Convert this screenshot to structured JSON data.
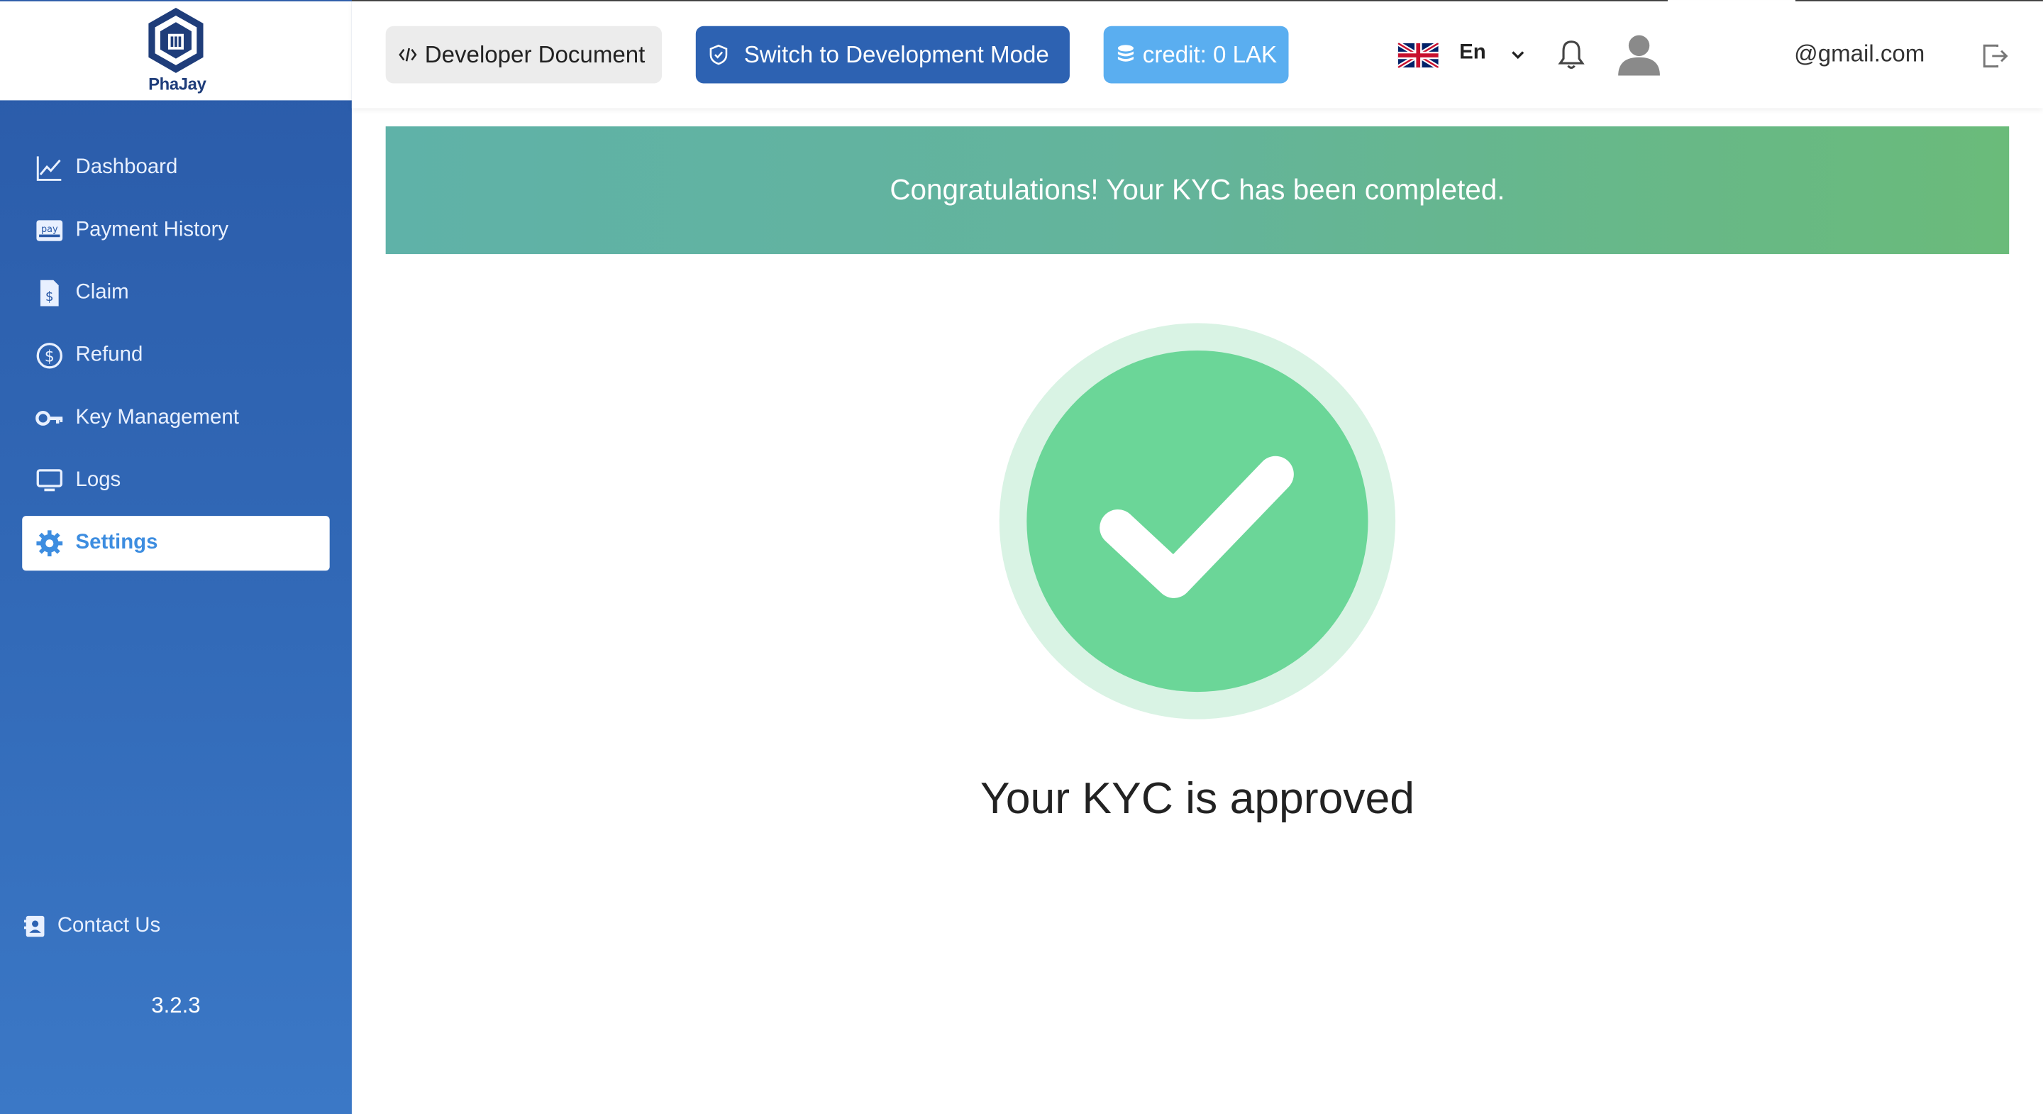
{
  "app": {
    "brand": "PhaJay",
    "version": "3.2.3"
  },
  "sidebar": {
    "items": [
      {
        "label": "Dashboard",
        "icon": "chart-line-icon"
      },
      {
        "label": "Payment History",
        "icon": "pay-card-icon"
      },
      {
        "label": "Claim",
        "icon": "invoice-dollar-icon"
      },
      {
        "label": "Refund",
        "icon": "refund-dollar-icon"
      },
      {
        "label": "Key Management",
        "icon": "key-icon"
      },
      {
        "label": "Logs",
        "icon": "monitor-icon"
      },
      {
        "label": "Settings",
        "icon": "gear-icon",
        "active": true
      }
    ],
    "contact_label": "Contact Us"
  },
  "header": {
    "developer_doc_label": "Developer Document",
    "dev_mode_label": "Switch to Development Mode",
    "credit_label": "credit: 0 LAK",
    "language": "En",
    "email": "@gmail.com"
  },
  "main": {
    "banner_text": "Congratulations! Your KYC has been completed.",
    "status_text": "Your KYC is approved"
  },
  "colors": {
    "sidebar_top": "#2a5aa8",
    "sidebar_bottom": "#3b78c6",
    "active_text": "#3d8de0",
    "dev_button": "#2d62b2",
    "credit_button": "#5aaef0",
    "banner_start": "#5fb2a8",
    "banner_end": "#6abb7a",
    "check_green": "#6bd698",
    "check_ring": "#d9f3e4"
  }
}
